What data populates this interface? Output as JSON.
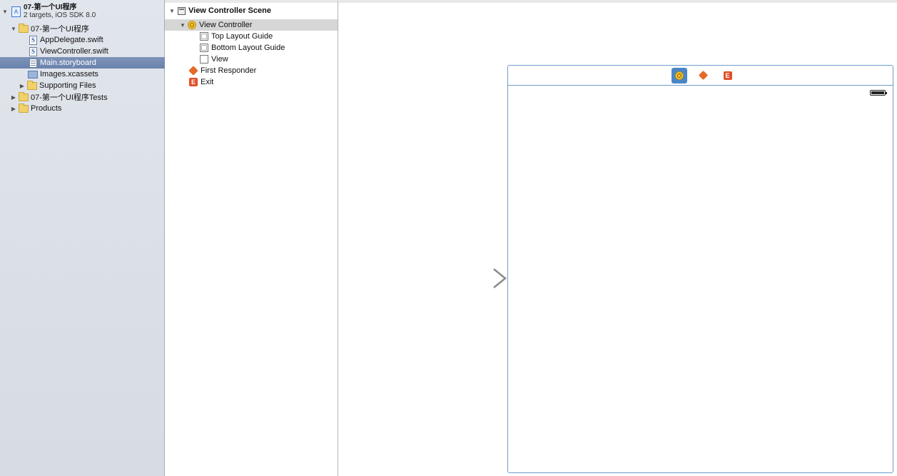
{
  "navigator": {
    "project": {
      "name": "07-第一个UI程序",
      "subtitle": "2 targets, iOS SDK 8.0"
    },
    "items": [
      {
        "label": "07-第一个UI程序",
        "kind": "folder",
        "expanded": true
      },
      {
        "label": "AppDelegate.swift",
        "kind": "swift"
      },
      {
        "label": "ViewController.swift",
        "kind": "swift"
      },
      {
        "label": "Main.storyboard",
        "kind": "storyboard",
        "selected": true
      },
      {
        "label": "Images.xcassets",
        "kind": "assets"
      },
      {
        "label": "Supporting Files",
        "kind": "folder",
        "expanded": false
      },
      {
        "label": "07-第一个UI程序Tests",
        "kind": "folder",
        "expanded": false
      },
      {
        "label": "Products",
        "kind": "folder",
        "expanded": false
      }
    ],
    "swift_glyph": "S",
    "project_glyph": "A"
  },
  "outline": {
    "scene": "View Controller Scene",
    "view_controller": "View Controller",
    "top_layout_guide": "Top Layout Guide",
    "bottom_layout_guide": "Bottom Layout Guide",
    "view": "View",
    "first_responder": "First Responder",
    "exit": "Exit",
    "exit_glyph": "E"
  },
  "canvas": {
    "dock_exit_glyph": "E"
  },
  "colors": {
    "navigator_selection": "#6a82ad",
    "outline_selection": "#d6d6d6",
    "frame_border": "#6e9ccc",
    "dock_active": "#4a86c7",
    "view_controller_icon": "#f4c430",
    "first_responder_icon": "#e56a2a",
    "exit_icon": "#e0502a"
  }
}
